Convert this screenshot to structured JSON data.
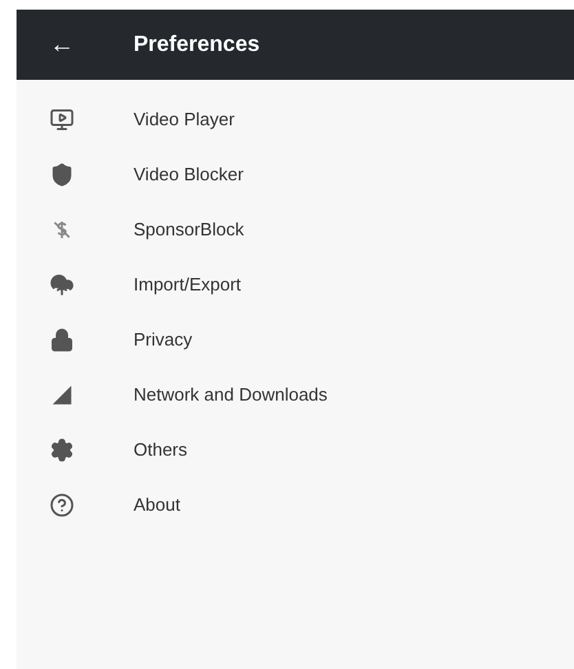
{
  "app_bar": {
    "back": "←",
    "title": "Preferences"
  },
  "items": [
    {
      "label": "Video Player",
      "kind": "player"
    },
    {
      "label": "Video Blocker",
      "kind": "shield"
    },
    {
      "label": "SponsorBlock",
      "kind": "sponsor"
    },
    {
      "label": "Import/Export",
      "kind": "cloud"
    },
    {
      "label": "Privacy",
      "kind": "lock"
    },
    {
      "label": "Network and Downloads",
      "kind": "network"
    },
    {
      "label": "Others",
      "kind": "gear"
    },
    {
      "label": "About",
      "kind": "help"
    }
  ]
}
